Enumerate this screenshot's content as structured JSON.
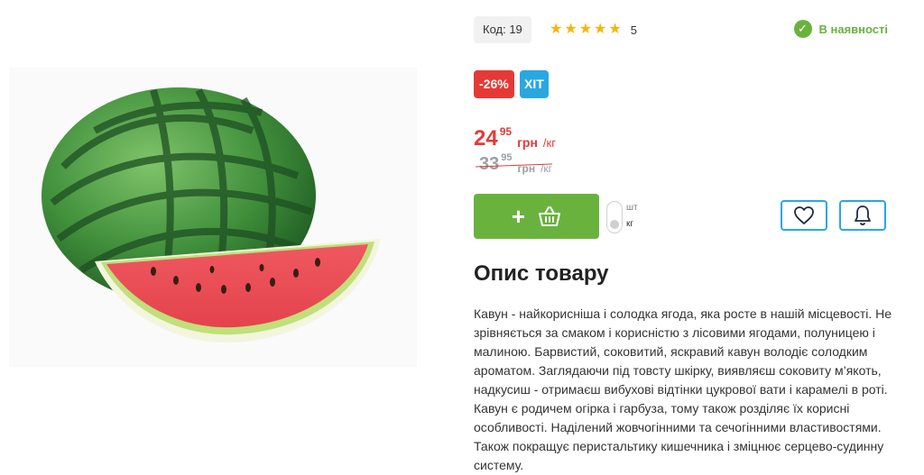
{
  "product": {
    "code_label": "Код: 19",
    "rating_count": "5",
    "stock_text": "В наявності",
    "badges": {
      "sale": "-26%",
      "hit": "ХІТ"
    },
    "price": {
      "int": "24",
      "frac": "95",
      "currency": "грн",
      "unit": "/кг"
    },
    "old_price": {
      "int": "33",
      "frac": "95",
      "currency": "грн",
      "unit": "/кг"
    },
    "unit_options": [
      "шт",
      "кг"
    ],
    "selected_unit": "кг",
    "description_title": "Опис товару",
    "description": "Кавун - найкорисніша і солодка ягода, яка росте в нашій місцевості. Не зрівняється за смаком і корисністю з лісовими ягодами, полуницею і малиною. Барвистий, соковитий, яскравий кавун володіє солодким ароматом. Заглядаючи під товсту шкірку, виявляєш соковиту м’якоть, надкусиш - отримаєш вибухові відтінки цукрової вати і карамелі в роті. Кавун є родичем огірка і гарбуза, тому також розділяє їх корисні особливості. Наділений жовчогінними та сечогінними властивостями. Також покращує перистальтику кишечника і зміцнює серцево-судинну систему."
  },
  "icons": {
    "stars": "star-icon",
    "stock": "check-circle-icon",
    "cart": "basket-icon",
    "favorite": "heart-icon",
    "notify": "bell-icon"
  },
  "colors": {
    "accent_green": "#6ab23e",
    "sale_red": "#e53935",
    "hit_blue": "#29a8e0",
    "star_yellow": "#f5b50a"
  }
}
